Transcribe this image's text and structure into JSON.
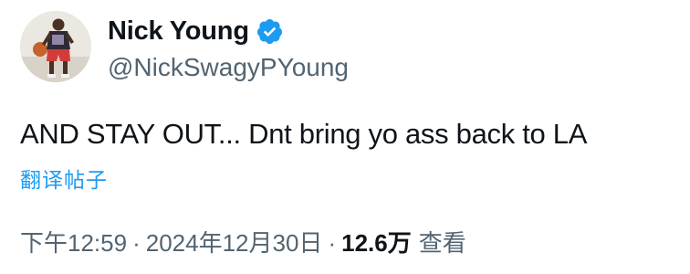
{
  "author": {
    "display_name": "Nick Young",
    "handle": "@NickSwagyPYoung",
    "verified_icon": "verified-badge-icon"
  },
  "tweet": {
    "text": "AND STAY OUT... Dnt bring yo ass back to LA",
    "translate_label": "翻译帖子"
  },
  "meta": {
    "time": "下午12:59",
    "separator": "·",
    "date": "2024年12月30日",
    "views_count": "12.6万",
    "views_label": "查看"
  },
  "colors": {
    "text": "#0f1419",
    "secondary": "#536471",
    "accent": "#1d9bf0"
  }
}
